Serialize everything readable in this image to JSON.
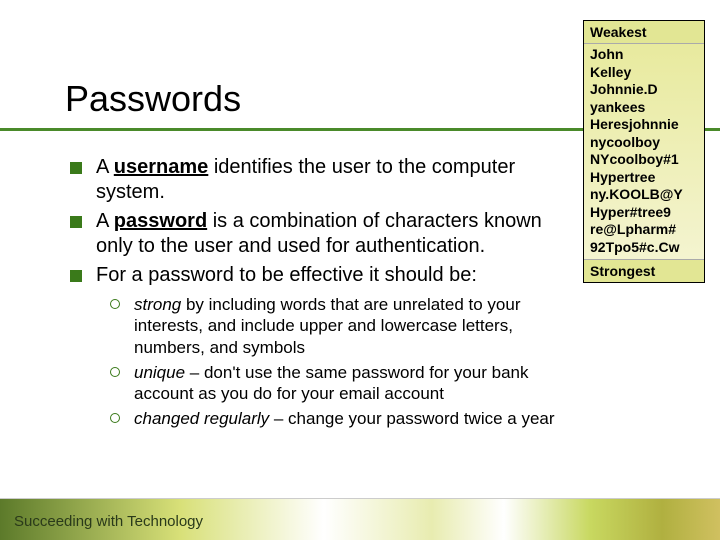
{
  "title": "Passwords",
  "bullets": [
    {
      "bold": "username",
      "pre": "A ",
      "post": " identifies the user to the computer system."
    },
    {
      "bold": "password",
      "pre": "A ",
      "post": " is a combination of characters known only to the user and used for authentication."
    },
    {
      "bold": "",
      "pre": "For a password to be effective it should be:",
      "post": ""
    }
  ],
  "subs": [
    {
      "it": "strong",
      "rest": " by including words that are unrelated to your interests, and include upper and lowercase letters, numbers, and symbols"
    },
    {
      "it": "unique",
      "rest": " – don't use the same password for your bank account as you do for your email account"
    },
    {
      "it": "changed regularly",
      "rest": " – change your password twice a year"
    }
  ],
  "sidebar": {
    "head": "Weakest",
    "items": [
      "John",
      "Kelley",
      "Johnnie.D",
      "yankees",
      "Heresjohnnie",
      "nycoolboy",
      "NYcoolboy#1",
      "Hypertree",
      "ny.KOOLB@Y",
      "Hyper#tree9",
      "re@Lpharm#",
      "92Tpo5#c.Cw"
    ],
    "foot": "Strongest"
  },
  "footer": "Succeeding with Technology"
}
